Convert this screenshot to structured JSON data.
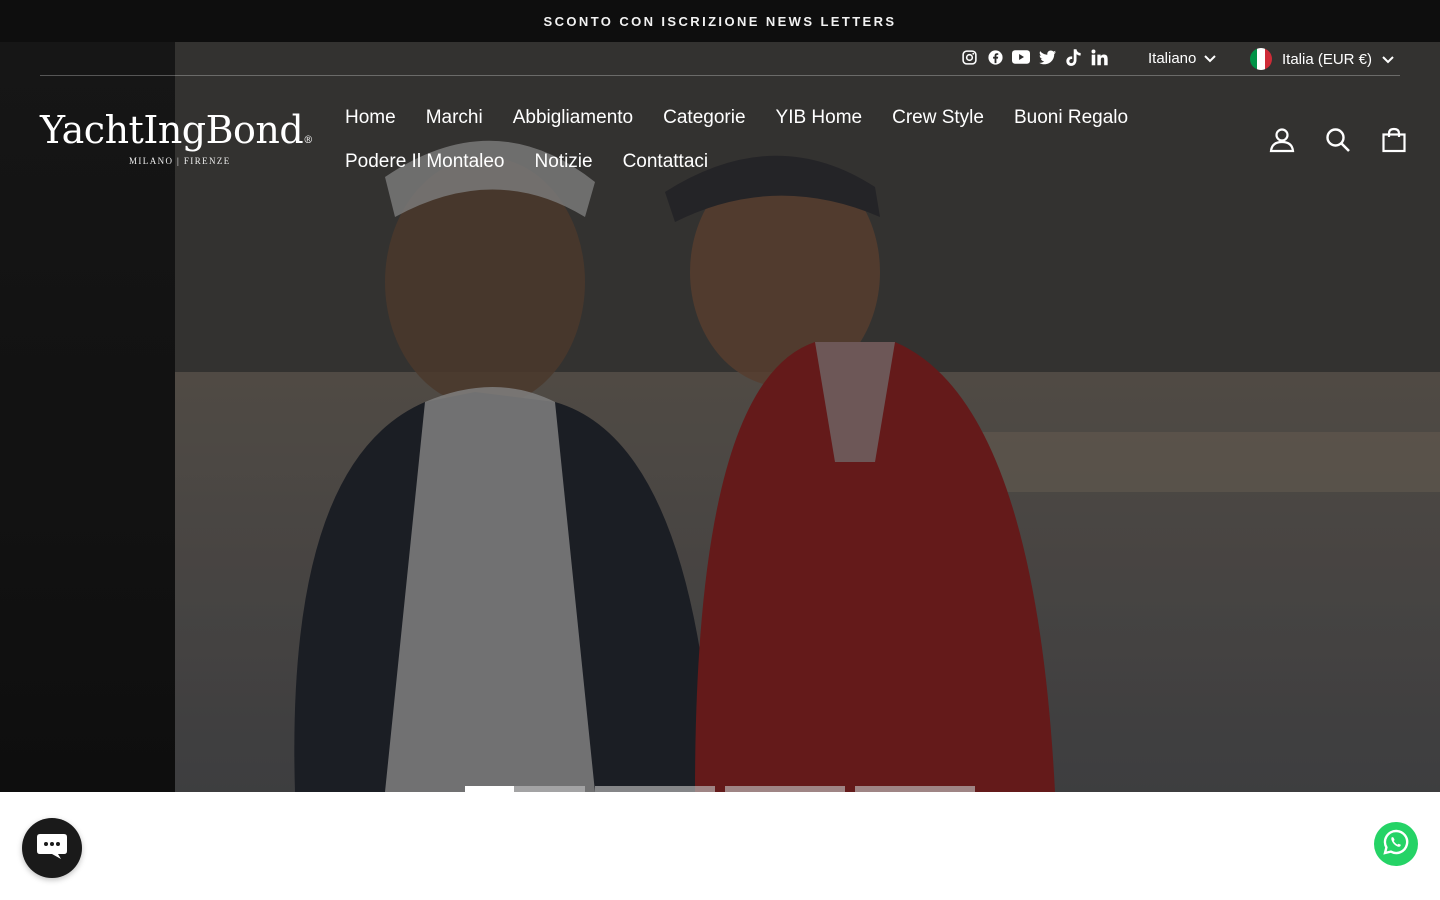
{
  "announcement": {
    "text": "SCONTO CON ISCRIZIONE NEWS LETTERS"
  },
  "social": {
    "icons": [
      "instagram-icon",
      "facebook-icon",
      "youtube-icon",
      "twitter-icon",
      "tiktok-icon",
      "linkedin-icon"
    ]
  },
  "language": {
    "selected": "Italiano"
  },
  "currency": {
    "selected": "Italia (EUR €)"
  },
  "logo": {
    "name": "YachtIngBond",
    "mark": "®",
    "tagline": "MILANO | FIRENZE"
  },
  "nav": {
    "items": [
      {
        "label": "Home"
      },
      {
        "label": "Marchi"
      },
      {
        "label": "Abbigliamento"
      },
      {
        "label": "Categorie"
      },
      {
        "label": "YIB Home"
      },
      {
        "label": "Crew Style"
      },
      {
        "label": "Buoni Regalo"
      },
      {
        "label": "Podere Il Montaleo"
      },
      {
        "label": "Notizie"
      },
      {
        "label": "Contattaci"
      }
    ]
  },
  "header_icons": [
    "account-icon",
    "search-icon",
    "cart-icon"
  ],
  "slider": {
    "slide_count": 4,
    "active_index": 0,
    "active_progress": 0.41
  },
  "colors": {
    "announcement_bg": "#0e0e0e",
    "flag_green": "#009246",
    "flag_white": "#ffffff",
    "flag_red": "#ce2b37",
    "chat_bg": "#1a1a1a",
    "whatsapp": "#25d366"
  }
}
